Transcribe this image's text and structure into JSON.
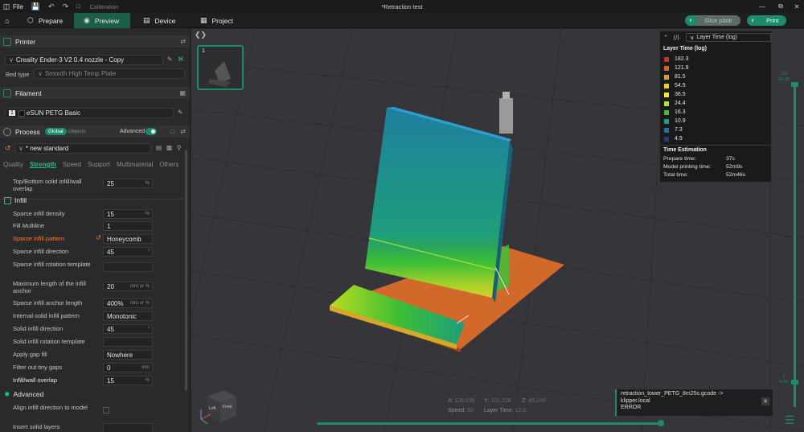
{
  "titlebar": {
    "file_label": "File",
    "calibration_label": "Calibration",
    "title": "*Retraction test"
  },
  "tabs": [
    {
      "label": "Prepare"
    },
    {
      "label": "Preview"
    },
    {
      "label": "Device"
    },
    {
      "label": "Project"
    }
  ],
  "actions": {
    "slice_label": "Slice plate",
    "print_label": "Print"
  },
  "printer": {
    "section_label": "Printer",
    "selected": "Creality Ender-3 V2 0.4 nozzle - Copy",
    "bed_type_label": "Bed type",
    "bed_type_value": "Smooth High Temp Plate"
  },
  "filament": {
    "section_label": "Filament",
    "index": "1",
    "name": "eSUN PETG Basic"
  },
  "process": {
    "section_label": "Process",
    "global_label": "Global",
    "objects_label": "Objects",
    "advanced_label": "Advanced",
    "preset": "* new standard",
    "tabs": [
      "Quality",
      "Strength",
      "Speed",
      "Support",
      "Multimaterial",
      "Others"
    ],
    "active_tab": "Strength"
  },
  "settings": {
    "top_overlap": {
      "label": "Top/Bottom solid infill/wall overlap",
      "value": "25",
      "unit": "%"
    },
    "infill_header": "Infill",
    "rows": [
      {
        "label": "Sparse infill density",
        "value": "15",
        "unit": "%"
      },
      {
        "label": "Fill Multiline",
        "value": "1",
        "unit": ""
      },
      {
        "label": "Sparse infill pattern",
        "value": "Honeycomb",
        "unit": ""
      },
      {
        "label": "Sparse infill direction",
        "value": "45",
        "unit": "°"
      },
      {
        "label": "Sparse infill rotation template",
        "value": "",
        "unit": ""
      },
      {
        "label": "Maximum length of the infill anchor",
        "value": "20",
        "unit": "mm or %"
      },
      {
        "label": "Sparse infill anchor length",
        "value": "400%",
        "unit": "mm or %"
      },
      {
        "label": "Internal solid infill pattern",
        "value": "Monotonic",
        "unit": ""
      },
      {
        "label": "Solid infill direction",
        "value": "45",
        "unit": "°"
      },
      {
        "label": "Solid infill rotation template",
        "value": "",
        "unit": ""
      },
      {
        "label": "Apply gap fill",
        "value": "Nowhere",
        "unit": ""
      },
      {
        "label": "Filter out tiny gaps",
        "value": "0",
        "unit": "mm"
      },
      {
        "label": "Infill/wall overlap",
        "value": "15",
        "unit": "%"
      }
    ],
    "advanced_header": "Advanced",
    "adv_rows": [
      {
        "label": "Align infill direction to model"
      },
      {
        "label": "Insert solid layers"
      }
    ]
  },
  "viewport": {
    "thumb_number": "1",
    "vslider_top": "126\n25.20",
    "vslider_bottom": "1\n0.20",
    "readout": {
      "x_label": "X:",
      "x": "118.036",
      "y_label": "Y:",
      "y": "101.228",
      "z_label": "Z:",
      "z": "45.200",
      "speed_label": "Speed:",
      "speed": "50",
      "layer_time_label": "Layer Time:",
      "layer_time": "12.0"
    },
    "cube_left": "Left",
    "cube_front": "Front"
  },
  "legend": {
    "select": "Layer Time (log)",
    "title": "Layer Time (log)",
    "items": [
      {
        "value": "182.3",
        "color": "#c0392b"
      },
      {
        "value": "121.9",
        "color": "#d4602a"
      },
      {
        "value": "81.5",
        "color": "#e09a2a"
      },
      {
        "value": "54.5",
        "color": "#e6d12a"
      },
      {
        "value": "36.5",
        "color": "#f0e62a"
      },
      {
        "value": "24.4",
        "color": "#b9dd22"
      },
      {
        "value": "16.3",
        "color": "#3fbf34"
      },
      {
        "value": "10.9",
        "color": "#1e9e7a"
      },
      {
        "value": "7.3",
        "color": "#1f6fa8"
      },
      {
        "value": "4.9",
        "color": "#1a3f8a"
      }
    ],
    "time_title": "Time Estimation",
    "times": [
      {
        "k": "Prepare time:",
        "v": "37s"
      },
      {
        "k": "Model printing time:",
        "v": "52m9s"
      },
      {
        "k": "Total time:",
        "v": "52m46s"
      }
    ]
  },
  "error": {
    "line1": "retraction_tower_PETG_8m25s.gcode ->",
    "line2": "klipper.local",
    "line3": "ERROR"
  },
  "colors": {
    "accent": "#1e8a6b",
    "warn": "#f07a3c"
  }
}
